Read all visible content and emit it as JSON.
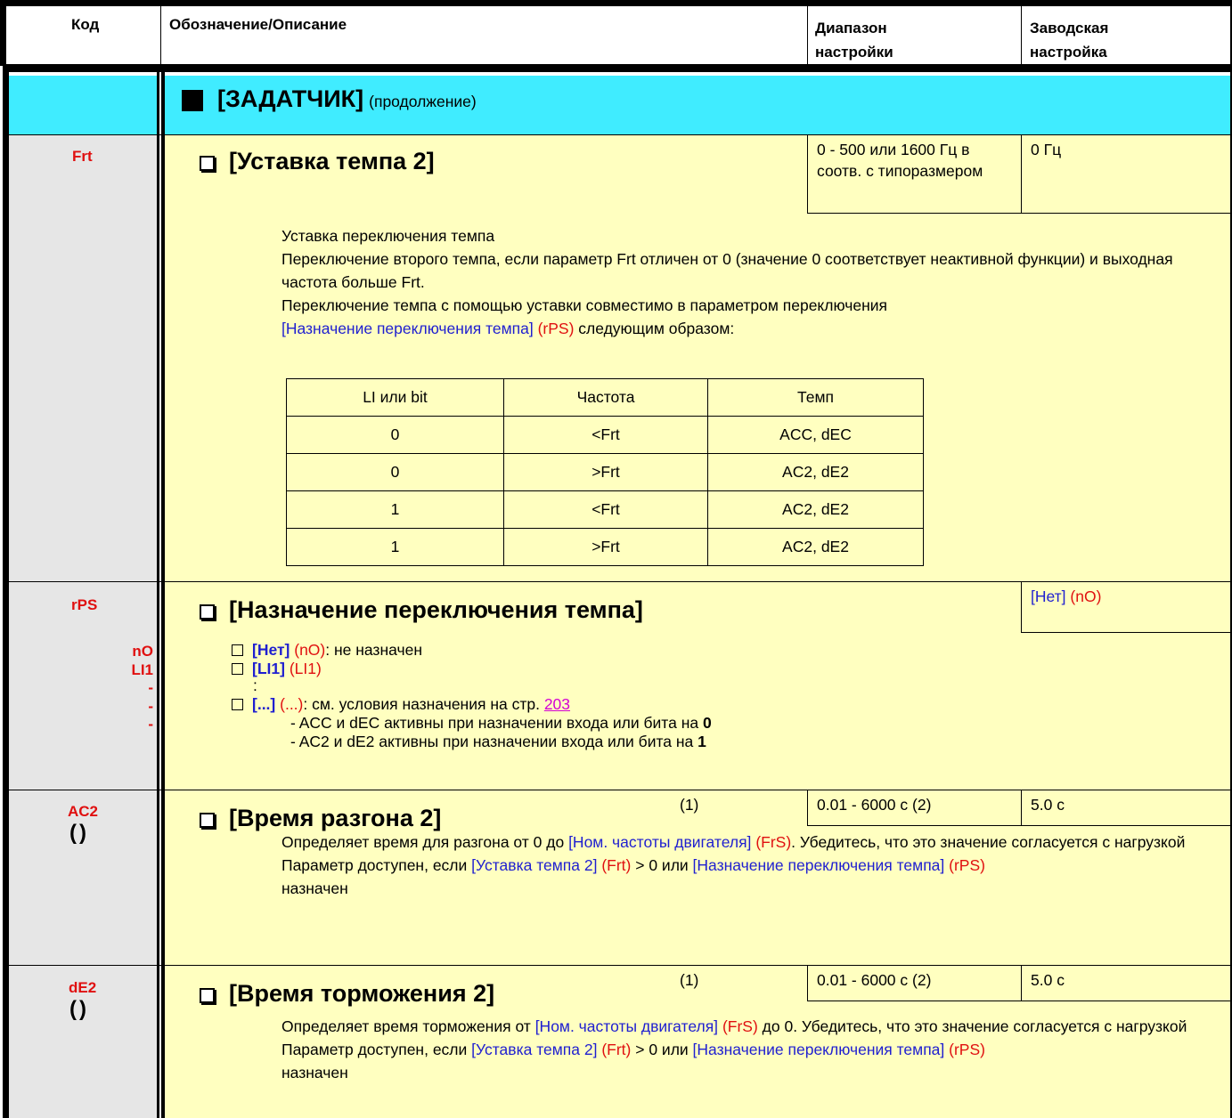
{
  "header": {
    "col_code": "Код",
    "col_desc": "Обозначение/Описание",
    "col_range": "Диапазон настройки",
    "col_default": "Заводская настройка"
  },
  "section": {
    "title": "[ЗАДАТЧИК]",
    "suffix": "(продолжение)"
  },
  "frt": {
    "code": "Frt",
    "name": "[Уставка темпа 2]",
    "range": "0 - 500 или 1600 Гц в соотв. с типоразмером",
    "default": "0 Гц",
    "line1": "Уставка переключения темпа",
    "line2": "Переключение второго темпа, если параметр Frt отличен от 0 (значение 0 соответствует неактивной функции) и выходная частота больше Frt.",
    "line3": "Переключение темпа с помощью уставки  совместимо в параметром переключения",
    "line4_link": "[Назначение переключения темпа]",
    "line4_code": "(rPS)",
    "line4_rest": " следующим образом:",
    "table_headers": [
      "LI или bit",
      "Частота",
      "Темп"
    ],
    "table_rows": [
      [
        "0",
        "<Frt",
        "ACC, dEC"
      ],
      [
        "0",
        ">Frt",
        "AC2, dE2"
      ],
      [
        "1",
        "<Frt",
        "AC2, dE2"
      ],
      [
        "1",
        ">Frt",
        "AC2, dE2"
      ]
    ]
  },
  "rps": {
    "code": "rPS",
    "name": "[Назначение переключения темпа]",
    "default_name": "[Нет]",
    "default_code": "(nO)",
    "side_codes": [
      "nO",
      "LI1",
      "-",
      "-",
      "-"
    ],
    "opt1_name": "[Нет]",
    "opt1_code": "(nO)",
    "opt1_rest": ": не назначен",
    "opt2_name": "[LI1]",
    "opt2_code": "(LI1)",
    "colon": ":",
    "opt3_name": "[...]",
    "opt3_code": "(...)",
    "opt3_rest": ": см. условия назначения на стр. ",
    "opt3_page": "203",
    "note1": "-  ACC и dEC активны при назначении входа или бита на ",
    "note1_val": "0",
    "note2": "-  AC2 и dE2 активны при назначении входа или бита на ",
    "note2_val": "1"
  },
  "ac2": {
    "code": "AC2",
    "icon": "()",
    "name": "[Время разгона 2]",
    "footnote": "(1)",
    "range": "0.01 - 6000 с (2)",
    "default": "5.0 с",
    "d1a": "Определяет время для разгона от 0 до ",
    "d1_link": "[Ном. частоты двигателя]",
    "d1_code": "(FrS)",
    "d1b": ". Убедитесь, что это значение согласуется с  нагрузкой",
    "d2a": "Параметр доступен, если ",
    "d2_link1": "[Уставка темпа 2]",
    "d2_code1": "(Frt)",
    "d2b": " > 0 или ",
    "d2_link2": "[Назначение переключения темпа]",
    "d2_code2": "(rPS)",
    "d2c": "назначен"
  },
  "de2": {
    "code": "dE2",
    "icon": "()",
    "name": "[Время торможения 2]",
    "footnote": "(1)",
    "range": "0.01 - 6000 с (2)",
    "default": "5.0 с",
    "d1a": "Определяет время торможения от ",
    "d1_link": "[Ном. частоты двигателя]",
    "d1_code": "(FrS)",
    "d1b": " до 0. Убедитесь, что это значение согласуется с  нагрузкой",
    "d2a": "Параметр доступен, если ",
    "d2_link1": "[Уставка темпа 2]",
    "d2_code1": "(Frt)",
    "d2b": " > 0 или  ",
    "d2_link2": "[Назначение переключения темпа]",
    "d2_code2": "(rPS)",
    "d2c": "назначен"
  },
  "colors": {
    "code_bg": "#e6e6e6",
    "yellow_bg": "#ffffc0",
    "cyan_bg": "#40ecff",
    "link": "#1f1fd0",
    "code_text": "#e01010"
  }
}
